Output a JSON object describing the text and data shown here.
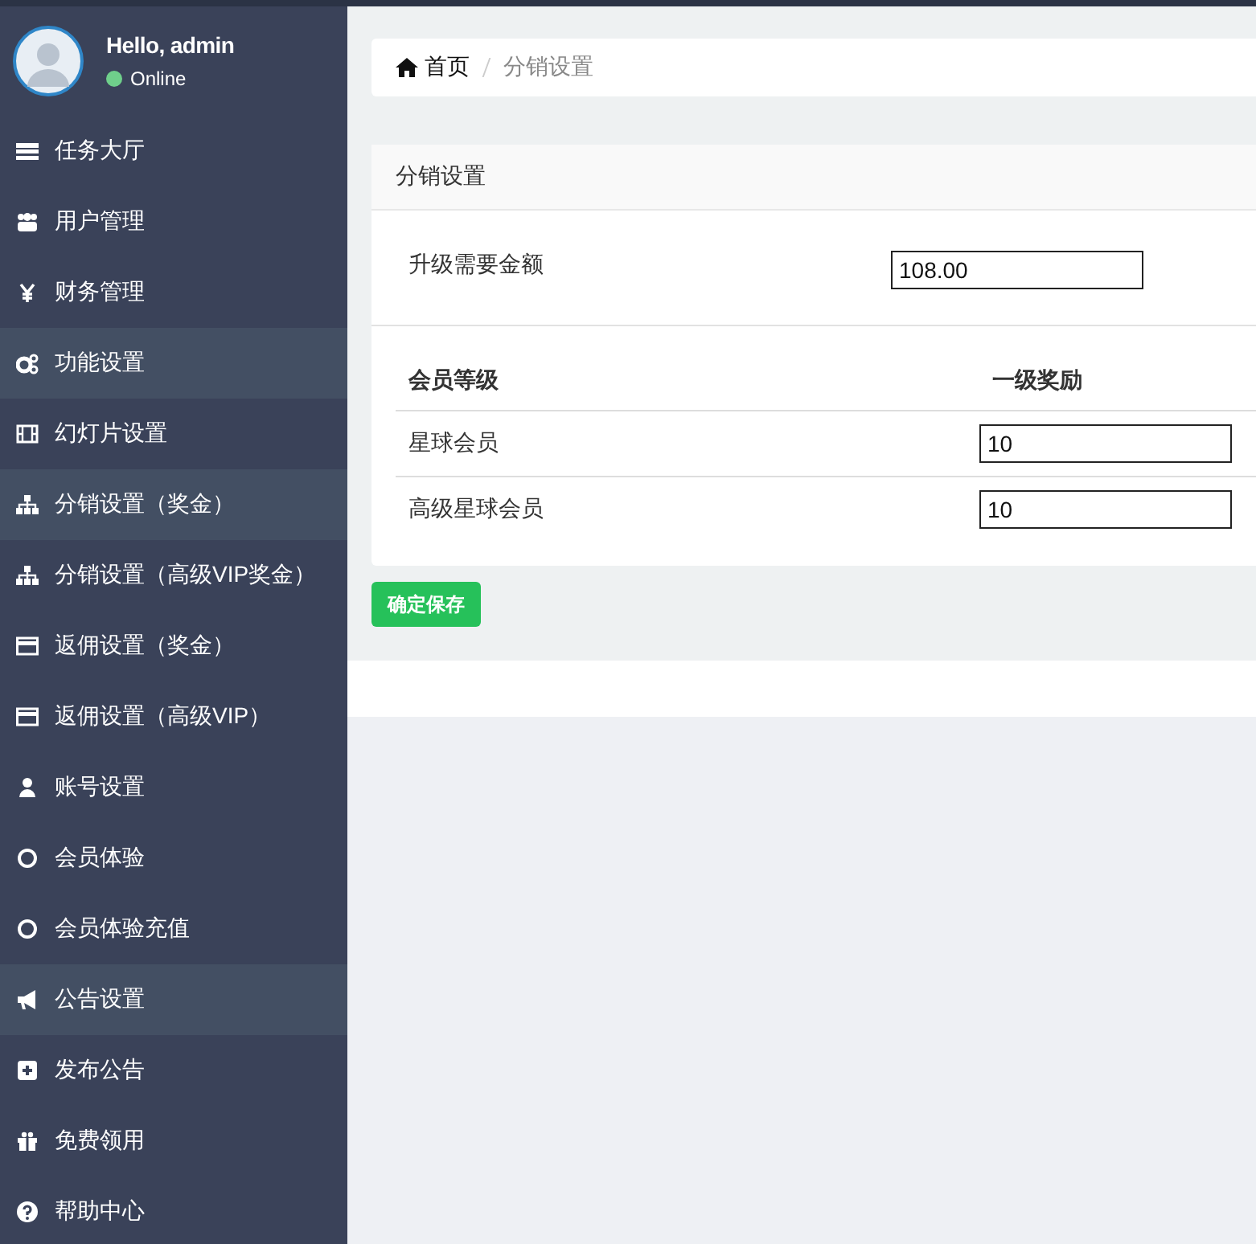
{
  "user": {
    "greeting": "Hello, admin",
    "status": "Online",
    "online": true
  },
  "sidebar": {
    "items": [
      {
        "label": "任务大厅",
        "selected": false
      },
      {
        "label": "用户管理",
        "selected": false
      },
      {
        "label": "财务管理",
        "selected": false
      },
      {
        "label": "功能设置",
        "selected": true
      },
      {
        "label": "幻灯片设置",
        "selected": false
      },
      {
        "label": "分销设置（奖金）",
        "selected": true
      },
      {
        "label": "分销设置（高级VIP奖金）",
        "selected": false
      },
      {
        "label": "返佣设置（奖金）",
        "selected": false
      },
      {
        "label": "返佣设置（高级VIP）",
        "selected": false
      },
      {
        "label": "账号设置",
        "selected": false
      },
      {
        "label": "会员体验",
        "selected": false
      },
      {
        "label": "会员体验充值",
        "selected": false
      },
      {
        "label": "公告设置",
        "selected": true
      },
      {
        "label": "发布公告",
        "selected": false
      },
      {
        "label": "免费领用",
        "selected": false
      },
      {
        "label": "帮助中心",
        "selected": false
      }
    ]
  },
  "breadcrumb": [
    "首页",
    "分销设置"
  ],
  "panel": {
    "title": "分销设置",
    "amount_label": "升级需要金额",
    "amount_value": "108.00",
    "table": {
      "columns": [
        "会员等级",
        "一级奖励"
      ],
      "rows": [
        {
          "level": "星球会员",
          "reward": "10"
        },
        {
          "level": "高级星球会员",
          "reward": "10"
        }
      ]
    }
  },
  "save_button": "确定保存"
}
